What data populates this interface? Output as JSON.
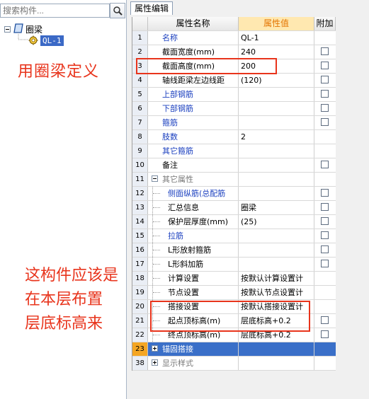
{
  "left": {
    "search_placeholder": "搜索构件...",
    "tree_root": "圈梁",
    "tree_child": "QL-1"
  },
  "annotations": {
    "note1": "用圈梁定义",
    "note2_line1": "这构件应该是",
    "note2_line2": "在本层布置",
    "note2_line3": "层底标高来"
  },
  "panel": {
    "tab": "属性编辑",
    "headers": {
      "name": "属性名称",
      "value": "属性值",
      "extra": "附加"
    }
  },
  "rows": [
    {
      "num": "1",
      "name": "名称",
      "value": "QL-1",
      "blue": true,
      "checkbox": false
    },
    {
      "num": "2",
      "name": "截面宽度(mm)",
      "value": "240",
      "blue": false,
      "checkbox": true
    },
    {
      "num": "3",
      "name": "截面高度(mm)",
      "value": "200",
      "blue": false,
      "checkbox": true
    },
    {
      "num": "4",
      "name": "轴线距梁左边线距",
      "value": "(120)",
      "blue": false,
      "checkbox": true
    },
    {
      "num": "5",
      "name": "上部钢筋",
      "value": "",
      "blue": true,
      "checkbox": true
    },
    {
      "num": "6",
      "name": "下部钢筋",
      "value": "",
      "blue": true,
      "checkbox": true
    },
    {
      "num": "7",
      "name": "箍筋",
      "value": "",
      "blue": true,
      "checkbox": true
    },
    {
      "num": "8",
      "name": "肢数",
      "value": "2",
      "blue": true,
      "checkbox": false
    },
    {
      "num": "9",
      "name": "其它箍筋",
      "value": "",
      "blue": true,
      "checkbox": false
    },
    {
      "num": "10",
      "name": "备注",
      "value": "",
      "blue": false,
      "checkbox": true
    },
    {
      "num": "11",
      "name": "其它属性",
      "value": "",
      "group": true
    },
    {
      "num": "12",
      "name": "侧面纵筋(总配筋",
      "value": "",
      "blue": true,
      "child": true,
      "checkbox": true
    },
    {
      "num": "13",
      "name": "汇总信息",
      "value": "圈梁",
      "blue": false,
      "child": true,
      "checkbox": true
    },
    {
      "num": "14",
      "name": "保护层厚度(mm)",
      "value": "(25)",
      "blue": false,
      "child": true,
      "checkbox": true
    },
    {
      "num": "15",
      "name": "拉筋",
      "value": "",
      "blue": true,
      "child": true,
      "checkbox": true
    },
    {
      "num": "16",
      "name": "L形放射箍筋",
      "value": "",
      "blue": false,
      "child": true,
      "checkbox": true
    },
    {
      "num": "17",
      "name": "L形斜加筋",
      "value": "",
      "blue": false,
      "child": true,
      "checkbox": true
    },
    {
      "num": "18",
      "name": "计算设置",
      "value": "按默认计算设置计",
      "blue": false,
      "child": true,
      "checkbox": false
    },
    {
      "num": "19",
      "name": "节点设置",
      "value": "按默认节点设置计",
      "blue": false,
      "child": true,
      "checkbox": false
    },
    {
      "num": "20",
      "name": "搭接设置",
      "value": "按默认搭接设置计",
      "blue": false,
      "child": true,
      "checkbox": false
    },
    {
      "num": "21",
      "name": "起点顶标高(m)",
      "value": "层底标高+0.2",
      "blue": false,
      "child": true,
      "checkbox": true
    },
    {
      "num": "22",
      "name": "终点顶标高(m)",
      "value": "层底标高+0.2",
      "blue": false,
      "child": true,
      "checkbox": true
    },
    {
      "num": "23",
      "name": "锚固搭接",
      "value": "",
      "collapsed": true,
      "selected": true
    },
    {
      "num": "38",
      "name": "显示样式",
      "value": "",
      "collapsed": true,
      "greyed": true
    }
  ]
}
